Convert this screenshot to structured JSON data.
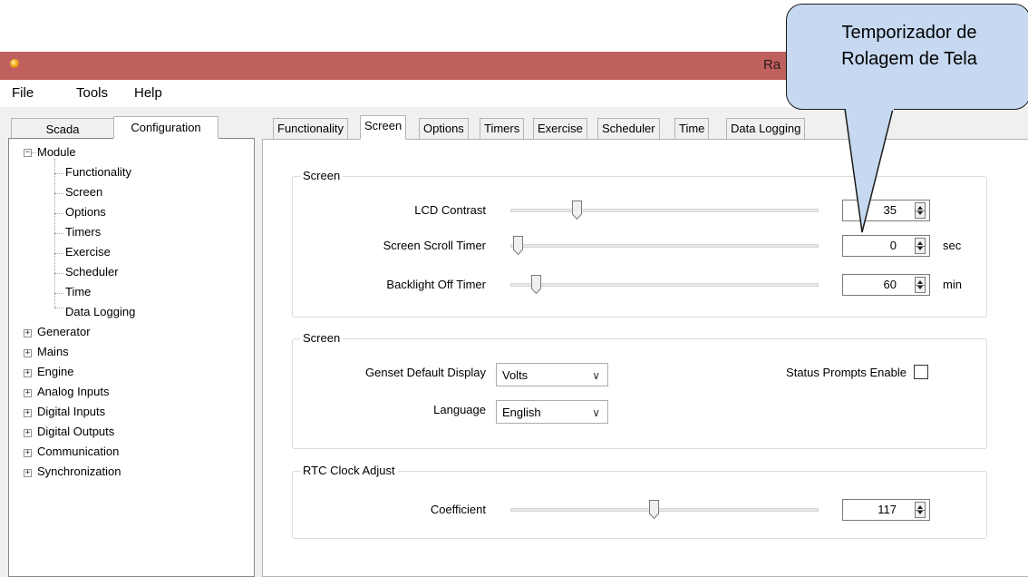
{
  "window": {
    "title": "Ra"
  },
  "menu": [
    "File",
    "Tools",
    "Help"
  ],
  "left_tabs": [
    "Scada",
    "Configuration"
  ],
  "tree": {
    "module": "Module",
    "module_children": [
      "Functionality",
      "Screen",
      "Options",
      "Timers",
      "Exercise",
      "Scheduler",
      "Time",
      "Data Logging"
    ],
    "others": [
      "Generator",
      "Mains",
      "Engine",
      "Analog Inputs",
      "Digital Inputs",
      "Digital Outputs",
      "Communication",
      "Synchronization"
    ]
  },
  "right_tabs": [
    "Functionality",
    "Screen",
    "Options",
    "Timers",
    "Exercise",
    "Scheduler",
    "Time",
    "Data Logging"
  ],
  "group1": {
    "title": "Screen",
    "lcd_contrast": {
      "label": "LCD Contrast",
      "value": "35",
      "level": 0.2
    },
    "scroll_timer": {
      "label": "Screen Scroll Timer",
      "value": "0",
      "unit": "sec",
      "level": 0.0
    },
    "backlight_timer": {
      "label": "Backlight Off Timer",
      "value": "60",
      "unit": "min",
      "level": 0.06
    }
  },
  "group2": {
    "title": "Screen",
    "genset_display": {
      "label": "Genset Default Display",
      "value": "Volts"
    },
    "language": {
      "label": "Language",
      "value": "English"
    },
    "status_prompts": {
      "label": "Status Prompts Enable",
      "checked": false
    }
  },
  "group3": {
    "title": "RTC Clock Adjust",
    "coefficient": {
      "label": "Coefficient",
      "value": "117",
      "level": 0.46
    }
  },
  "callout": {
    "line1": "Temporizador de",
    "line2": "Rolagem de Tela",
    "color": "#c6d9f1"
  }
}
